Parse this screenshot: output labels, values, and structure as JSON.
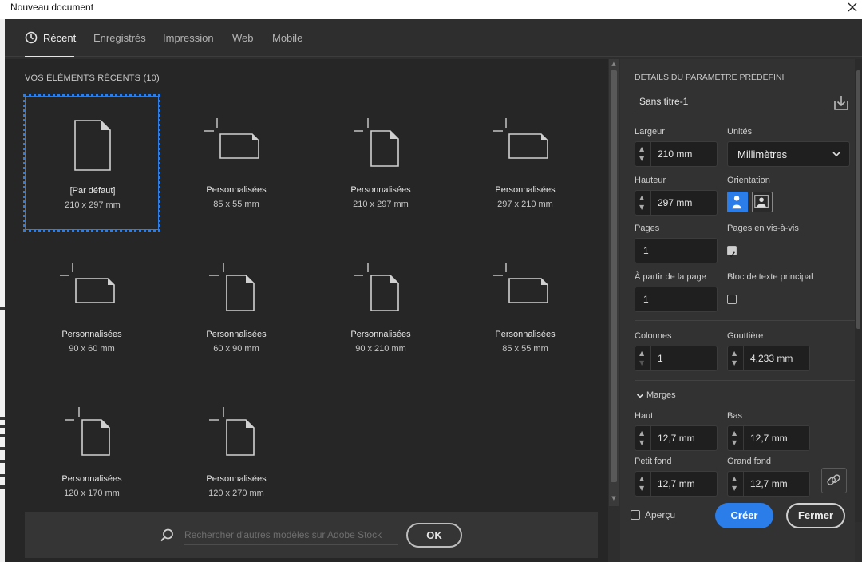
{
  "window": {
    "title": "Nouveau document"
  },
  "tabs": [
    {
      "label": "Récent",
      "active": true
    },
    {
      "label": "Enregistrés"
    },
    {
      "label": "Impression"
    },
    {
      "label": "Web"
    },
    {
      "label": "Mobile"
    }
  ],
  "recent": {
    "title": "VOS ÉLÉMENTS RÉCENTS",
    "count": "(10)",
    "items": [
      {
        "name": "[Par défaut]",
        "size": "210 x 297 mm",
        "icon": "portrait-page-icon",
        "selected": true
      },
      {
        "name": "Personnalisées",
        "size": "85 x 55 mm",
        "icon": "landscape-custom-icon"
      },
      {
        "name": "Personnalisées",
        "size": "210 x 297 mm",
        "icon": "portrait-custom-icon"
      },
      {
        "name": "Personnalisées",
        "size": "297 x 210 mm",
        "icon": "landscape-custom-icon"
      },
      {
        "name": "Personnalisées",
        "size": "90 x 60 mm",
        "icon": "landscape-custom-icon"
      },
      {
        "name": "Personnalisées",
        "size": "60 x 90 mm",
        "icon": "portrait-custom-icon"
      },
      {
        "name": "Personnalisées",
        "size": "90 x 210 mm",
        "icon": "portrait-custom-icon"
      },
      {
        "name": "Personnalisées",
        "size": "85 x 55 mm",
        "icon": "landscape-custom-icon"
      },
      {
        "name": "Personnalisées",
        "size": "120 x 170 mm",
        "icon": "portrait-custom-icon"
      },
      {
        "name": "Personnalisées",
        "size": "120 x 270 mm",
        "icon": "portrait-custom-icon"
      }
    ]
  },
  "search": {
    "placeholder": "Rechercher d'autres modèles sur Adobe Stock",
    "ok_label": "OK"
  },
  "preset": {
    "title": "DÉTAILS DU PARAMÈTRE PRÉDÉFINI",
    "name": "Sans titre-1",
    "width_label": "Largeur",
    "width_value": "210 mm",
    "units_label": "Unités",
    "units_value": "Millimètres",
    "height_label": "Hauteur",
    "height_value": "297 mm",
    "orientation_label": "Orientation",
    "pages_label": "Pages",
    "pages_value": "1",
    "facing_label": "Pages en vis-à-vis",
    "facing_checked": true,
    "start_label": "À partir de la page",
    "start_value": "1",
    "textframe_label": "Bloc de texte principal",
    "textframe_checked": false,
    "columns_label": "Colonnes",
    "columns_value": "1",
    "gutter_label": "Gouttière",
    "gutter_value": "4,233 mm",
    "margins_label": "Marges",
    "top_label": "Haut",
    "top_value": "12,7 mm",
    "bottom_label": "Bas",
    "bottom_value": "12,7 mm",
    "inside_label": "Petit fond",
    "inside_value": "12,7 mm",
    "outside_label": "Grand fond",
    "outside_value": "12,7 mm"
  },
  "footer": {
    "preview_label": "Aperçu",
    "create_label": "Créer",
    "close_label": "Fermer"
  },
  "colors": {
    "accent": "#2b7de9",
    "panel": "#323232",
    "main": "#262626"
  }
}
